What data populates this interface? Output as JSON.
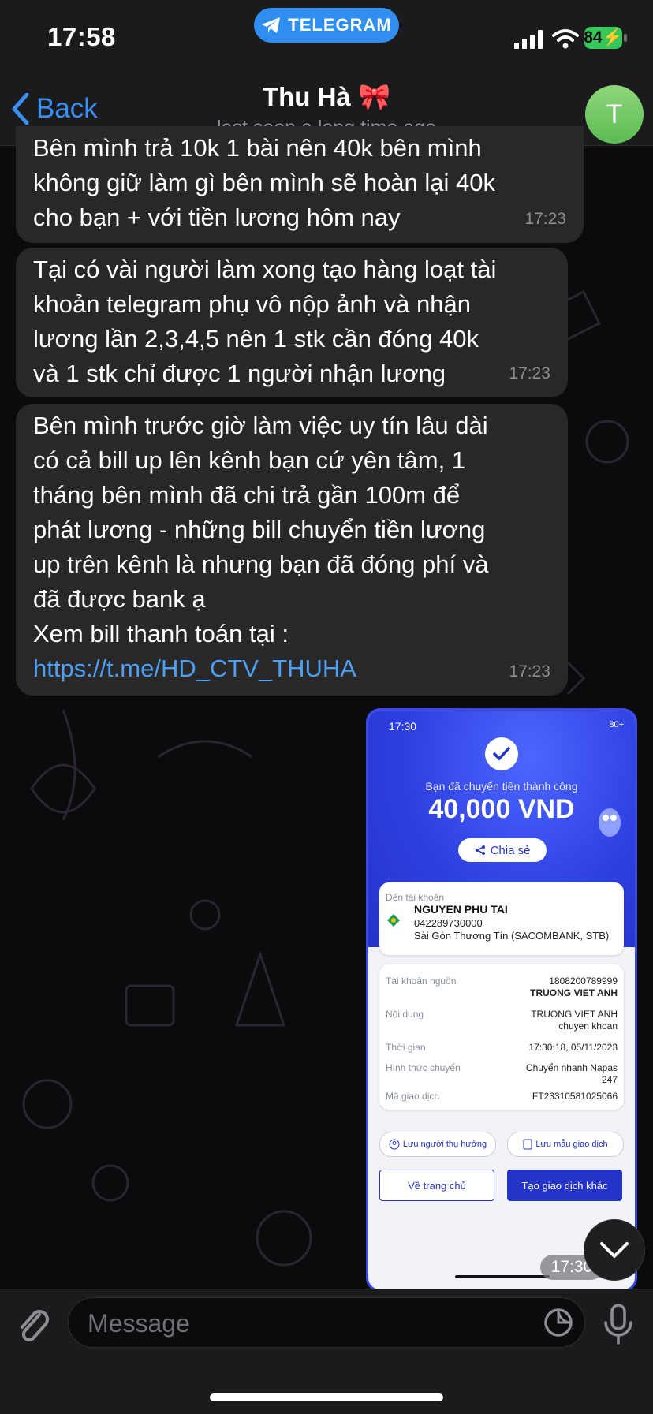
{
  "status_bar": {
    "time": "17:58",
    "app_pill": "TELEGRAM",
    "battery": "84"
  },
  "header": {
    "back_label": "Back",
    "title": "Thu Hà 🎀",
    "subtitle": "last seen a long time ago",
    "avatar_letter": "T"
  },
  "messages": [
    {
      "text": "Bên mình trả 10k 1 bài nên 40k bên mình\nkhông giữ làm gì bên mình sẽ hoàn lại 40k\ncho bạn + với tiền lương hôm nay",
      "time": "17:23"
    },
    {
      "text": "Tại có vài người làm xong tạo hàng loạt tài\nkhoản telegram phụ vô nộp ảnh và nhận\nlương lần 2,3,4,5 nên 1 stk cần đóng 40k\nvà 1 stk chỉ được 1 người nhận lương",
      "time": "17:23"
    },
    {
      "text": "Bên mình trước giờ làm việc uy tín lâu dài\ncó cả bill up lên kênh bạn cứ yên tâm, 1\ntháng bên mình đã chi trả gần 100m để\nphát lương - những bill chuyển tiền lương\nup trên kênh là nhưng bạn đã đóng phí và\nđã được bank ạ\nXem bill thanh toán tại :",
      "link": "https://t.me/HD_CTV_THUHA",
      "time": "17:23"
    }
  ],
  "photo": {
    "time": "17:30",
    "battery": "80+",
    "success_msg": "Bạn đã chuyển tiền thành công",
    "amount": "40,000 VND",
    "share_label": "Chia sẻ",
    "to_account_label": "Đến tài khoản",
    "recipient_name": "NGUYEN PHU TAI",
    "recipient_account": "042289730000",
    "recipient_bank": "Sài Gòn Thương Tín (SACOMBANK, STB)",
    "details": [
      {
        "key": "Tài khoản nguồn",
        "value": "1808200789999",
        "value2": "TRUONG VIET ANH"
      },
      {
        "key": "Nội dung",
        "value": "TRUONG VIET ANH",
        "value2": "chuyen khoan"
      },
      {
        "key": "Thời gian",
        "value": "17:30:18, 05/11/2023",
        "value2": ""
      },
      {
        "key": "Hình thức chuyển",
        "value": "Chuyển nhanh Napas",
        "value2": "247"
      },
      {
        "key": "Mã giao dịch",
        "value": "FT23310581025066",
        "value2": ""
      }
    ],
    "save_recipient": "Lưu người thụ hưởng",
    "save_template": "Lưu mẫu giao dịch",
    "home_button": "Về trang chủ",
    "new_tx_button": "Tạo giao dịch khác",
    "stamp_time": "17:30"
  },
  "input": {
    "placeholder": "Message"
  },
  "colors": {
    "accent": "#3a8ff5",
    "bubble": "#2a2729",
    "bank_blue": "#2434c9",
    "avatar_green": "#6cc55f"
  }
}
